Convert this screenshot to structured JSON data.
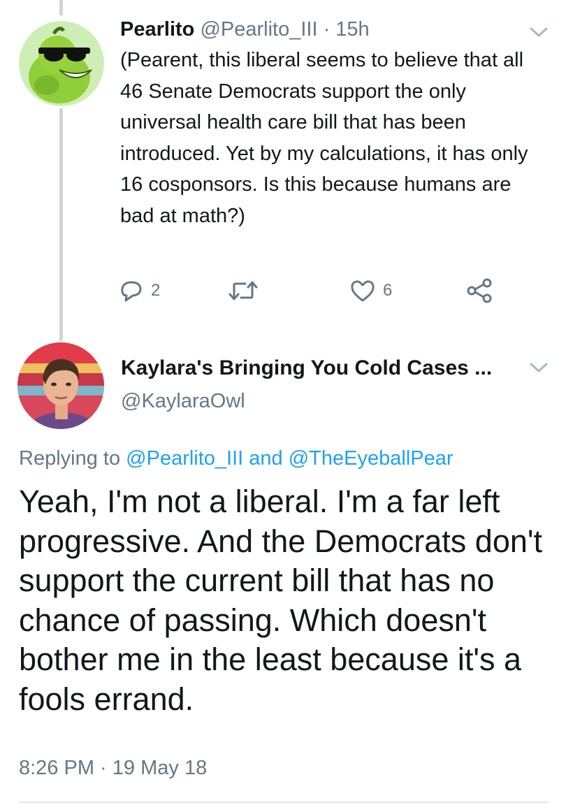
{
  "tweet1": {
    "display_name": "Pearlito",
    "handle": "@Pearlito_III",
    "separator": " · ",
    "time": "15h",
    "text": "(Pearent, this liberal seems to believe that all 46 Senate Democrats support the only universal health care bill that has been introduced. Yet by my calculations, it has only 16 cosponsors. Is this because humans are bad at math?)",
    "reply_count": "2",
    "retweet_count": "",
    "like_count": "6"
  },
  "tweet2": {
    "display_name": "Kaylara's Bringing You Cold Cases ...",
    "handle": "@KaylaraOwl",
    "replying_prefix": "Replying to ",
    "replying_user1": "@Pearlito_III",
    "replying_and": " and ",
    "replying_user2": "@TheEyeballPear",
    "text": "Yeah, I'm not a liberal. I'm a far left progressive.  And the Democrats don't support the current bill that has no chance of passing. Which doesn't bother me in the least because it's a fools errand.",
    "time": "8:26 PM",
    "separator": " · ",
    "date": "19 May 18"
  },
  "colors": {
    "text": "#14171a",
    "secondary": "#657786",
    "link": "#1da1f2",
    "thread_line": "#ccd6dd",
    "divider": "#e1e8ed"
  },
  "icons": [
    "chevron-down-icon",
    "reply-icon",
    "retweet-icon",
    "like-icon",
    "share-icon"
  ]
}
